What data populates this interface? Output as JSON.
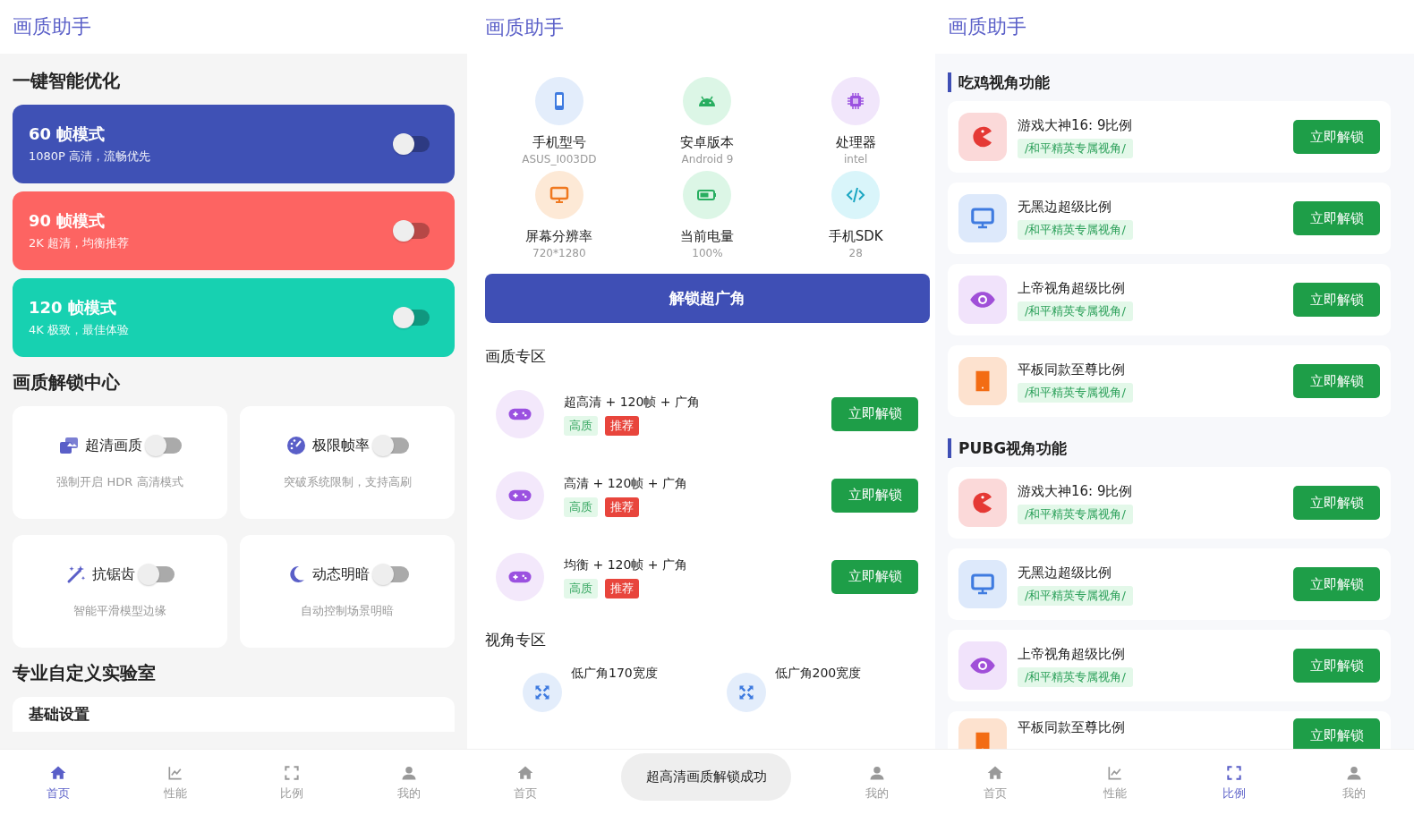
{
  "home_screen": {
    "title": "画质助手",
    "optimize": {
      "heading": "一键智能优化",
      "modes": [
        {
          "name": "60 帧模式",
          "description": "1080P 高清，流畅优先",
          "color": "#3f51b5",
          "on": false
        },
        {
          "name": "90 帧模式",
          "description": "2K 超清，均衡推荐",
          "color": "#fd6462",
          "on": false
        },
        {
          "name": "120 帧模式",
          "description": "4K 极致，最佳体验",
          "color": "#17d1b1",
          "on": false
        }
      ]
    },
    "unlock_center": {
      "heading": "画质解锁中心",
      "features": [
        {
          "kind": "photos",
          "label": "超清画质",
          "description": "强制开启 HDR 高清模式",
          "on": false
        },
        {
          "kind": "gauge",
          "label": "极限帧率",
          "description": "突破系统限制，支持高刷",
          "on": false
        },
        {
          "kind": "wand",
          "label": "抗锯齿",
          "description": "智能平滑模型边缘",
          "on": false
        },
        {
          "kind": "moon",
          "label": "动态明暗",
          "description": "自动控制场景明暗",
          "on": false
        }
      ]
    },
    "lab": {
      "heading": "专业自定义实验室",
      "card_title": "基础设置"
    },
    "nav": [
      {
        "kind": "home",
        "label": "首页",
        "selected": true
      },
      {
        "kind": "chart",
        "label": "性能",
        "selected": false
      },
      {
        "kind": "corners",
        "label": "比例",
        "selected": false
      },
      {
        "kind": "user",
        "label": "我的",
        "selected": false
      }
    ]
  },
  "device_screen": {
    "title": "画质助手",
    "info": [
      {
        "kind": "phone",
        "label": "手机型号",
        "value": "ASUS_I003DD"
      },
      {
        "kind": "robot",
        "label": "安卓版本",
        "value": "Android 9"
      },
      {
        "kind": "chip",
        "label": "处理器",
        "value": "intel"
      },
      {
        "kind": "monitor",
        "label": "屏幕分辨率",
        "value": "720*1280"
      },
      {
        "kind": "battery",
        "label": "当前电量",
        "value": "100%"
      },
      {
        "kind": "code",
        "label": "手机SDK",
        "value": "28"
      }
    ],
    "unlock_button": "解锁超广角",
    "quality_zone": {
      "heading": "画质专区",
      "items": [
        {
          "name": "超高清 + 120帧 + 广角",
          "tags": [
            {
              "kind": "quality",
              "text": "高质"
            },
            {
              "kind": "recommend",
              "text": "推荐"
            }
          ],
          "button": "立即解锁"
        },
        {
          "name": "高清 + 120帧 + 广角",
          "tags": [
            {
              "kind": "quality",
              "text": "高质"
            },
            {
              "kind": "recommend",
              "text": "推荐"
            }
          ],
          "button": "立即解锁"
        },
        {
          "name": "均衡 + 120帧 + 广角",
          "tags": [
            {
              "kind": "quality",
              "text": "高质"
            },
            {
              "kind": "recommend",
              "text": "推荐"
            }
          ],
          "button": "立即解锁"
        }
      ]
    },
    "view_zone": {
      "heading": "视角专区",
      "items": [
        {
          "name": "低广角170宽度"
        },
        {
          "name": "低广角200宽度"
        }
      ]
    },
    "nav": [
      {
        "kind": "home",
        "label": "首页",
        "selected": false
      },
      {
        "kind": "covered"
      },
      {
        "kind": "covered"
      },
      {
        "kind": "user",
        "label": "我的",
        "selected": false
      }
    ],
    "toast": "超高清画质解锁成功"
  },
  "ratio_screen": {
    "title": "画质助手",
    "groups": [
      {
        "heading": "吃鸡视角功能",
        "items": [
          {
            "kind": "pacman",
            "name": "游戏大神16: 9比例",
            "tag": "/和平精英专属视角/",
            "button": "立即解锁"
          },
          {
            "kind": "monitor",
            "name": "无黑边超级比例",
            "tag": "/和平精英专属视角/",
            "button": "立即解锁"
          },
          {
            "kind": "eye",
            "name": "上帝视角超级比例",
            "tag": "/和平精英专属视角/",
            "button": "立即解锁"
          },
          {
            "kind": "tablet",
            "name": "平板同款至尊比例",
            "tag": "/和平精英专属视角/",
            "button": "立即解锁"
          }
        ]
      },
      {
        "heading": "PUBG视角功能",
        "items": [
          {
            "kind": "pacman",
            "name": "游戏大神16: 9比例",
            "tag": "/和平精英专属视角/",
            "button": "立即解锁"
          },
          {
            "kind": "monitor",
            "name": "无黑边超级比例",
            "tag": "/和平精英专属视角/",
            "button": "立即解锁"
          },
          {
            "kind": "eye",
            "name": "上帝视角超级比例",
            "tag": "/和平精英专属视角/",
            "button": "立即解锁"
          },
          {
            "kind": "tablet",
            "name": "平板同款至尊比例",
            "button": "立即解锁"
          }
        ]
      }
    ],
    "nav": [
      {
        "kind": "home",
        "label": "首页",
        "selected": false
      },
      {
        "kind": "chart",
        "label": "性能",
        "selected": false
      },
      {
        "kind": "corners",
        "label": "比例",
        "selected": true
      },
      {
        "kind": "user",
        "label": "我的",
        "selected": false
      }
    ]
  }
}
